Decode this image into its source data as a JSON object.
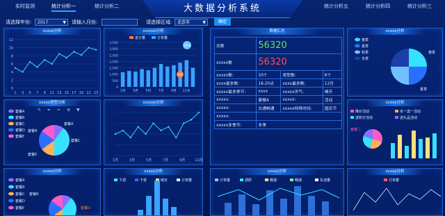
{
  "nav": {
    "items": [
      "实时监测",
      "统计分析一",
      "统计分析二",
      "统计分析五",
      "统计分析四",
      "统计分析三"
    ],
    "title": "大数据分析系统"
  },
  "filters": {
    "year_label": "请选择年份:",
    "year_value": "2017",
    "month_label": "请输入月份:",
    "month_value": "",
    "region_label": "请选择区域:",
    "region_value": "北京市",
    "confirm": "确定"
  },
  "panels": {
    "p1": {
      "title": "xxxxx分析"
    },
    "p2": {
      "title": "xxxxxx分析",
      "legend": [
        "进订量",
        "订单量"
      ],
      "bubble_top": "20.0",
      "bubble_bottom": "136"
    },
    "p3": {
      "title": "数据汇总"
    },
    "p4": {
      "title": "xxxxx分析",
      "legend": [
        "春季",
        "夏季",
        "秋季",
        "冬季"
      ],
      "label_a": "春季",
      "label_b": "夏季"
    },
    "p5": {
      "title": "xxxxx类型分析",
      "legend": [
        "套餐A",
        "套餐B",
        "套餐C",
        "套餐D",
        "套餐E"
      ],
      "label_a": "套餐A",
      "label_b": "套餐B",
      "label_c": "套餐C",
      "label_e": "套餐E"
    },
    "p6": {
      "title": "xxxxxx分析"
    },
    "p8": {
      "title": "xxxxx分析",
      "legend": [
        "降价活动",
        "买一送一活动",
        "送积分活动",
        "送礼品活动"
      ],
      "label_d": "套餐二"
    },
    "p9": {
      "title": "xxxxx分析",
      "legend": [
        "套餐A",
        "套餐B",
        "套餐C",
        "套餐D",
        "套餐E"
      ],
      "label_b": "套餐B",
      "label_d": "套餐D"
    },
    "p10": {
      "title": "xxxxx分析",
      "legend": [
        "下调",
        "下变",
        "晴天",
        "订单量"
      ]
    },
    "p11": {
      "title": "xxxxx分析",
      "legend": [
        "订单量",
        "调研",
        "畅通",
        "畅通",
        "车流量"
      ]
    },
    "p12": {
      "title": "xxxxx分析",
      "legend": [
        "订单量"
      ]
    }
  },
  "summary": {
    "total_label": "总数",
    "total_value": "56320",
    "xxx_label": "xxxxx数",
    "xxx_value": "56320",
    "rows": [
      [
        "xxxxx数:",
        "10个",
        "类型数:",
        "6个"
      ],
      [
        "xxxx最多数:",
        "16-20点",
        "xxxx最多数:",
        "12月"
      ],
      [
        "xxxxx最多季节:",
        "xxxx",
        "xxxxx天气:",
        "晴天"
      ],
      [
        "xxxxx:",
        "套餐A",
        "xxxxx:",
        "活动"
      ],
      [
        "xxxxx:",
        "交通畅通",
        "xxxxx特殊时间:",
        "国庆节"
      ],
      [
        "xxxxx:",
        "",
        "",
        ""
      ],
      [
        "xxxxx多季节:",
        "冬季",
        "",
        ""
      ]
    ]
  },
  "chart_data": [
    {
      "type": "line",
      "x": [
        "1",
        "3",
        "5",
        "7",
        "9",
        "11",
        "13",
        "15",
        "17",
        "19",
        "21",
        "23"
      ],
      "ylim": [
        0,
        12
      ],
      "yticks": [
        "0",
        "2",
        "4",
        "6",
        "8",
        "10",
        "12"
      ],
      "values": [
        5,
        4,
        6.5,
        5.2,
        7,
        6,
        8.5,
        7.5,
        9,
        8.2,
        10,
        9.5
      ]
    },
    {
      "type": "bar",
      "categories": [
        "1月",
        "3月",
        "5月",
        "7月",
        "9月",
        "11月"
      ],
      "ylim": [
        0,
        3500
      ],
      "yticks": [
        "0",
        "500",
        "1,000",
        "1,500",
        "2,000",
        "2,500",
        "3,000",
        "3,500"
      ],
      "values": [
        1150,
        1250,
        1200,
        1400,
        1300,
        1500,
        1800,
        1600,
        1700,
        1900,
        2100,
        1500
      ]
    },
    {
      "type": "pie",
      "series": [
        {
          "name": "春季",
          "value": 25
        },
        {
          "name": "夏季",
          "value": 25
        },
        {
          "name": "秋季",
          "value": 25
        },
        {
          "name": "冬季",
          "value": 25
        }
      ]
    },
    {
      "type": "pie",
      "series": [
        {
          "name": "套餐A",
          "value": 10
        },
        {
          "name": "套餐B",
          "value": 40
        },
        {
          "name": "套餐C",
          "value": 15
        },
        {
          "name": "套餐D",
          "value": 20
        },
        {
          "name": "套餐E",
          "value": 15
        }
      ]
    },
    {
      "type": "line",
      "categories": [
        "1月",
        "3月",
        "5月",
        "7月",
        "9月",
        "11月"
      ],
      "values": [
        6,
        7,
        5,
        8,
        6,
        9,
        7,
        8,
        5,
        9,
        10,
        12
      ]
    }
  ]
}
